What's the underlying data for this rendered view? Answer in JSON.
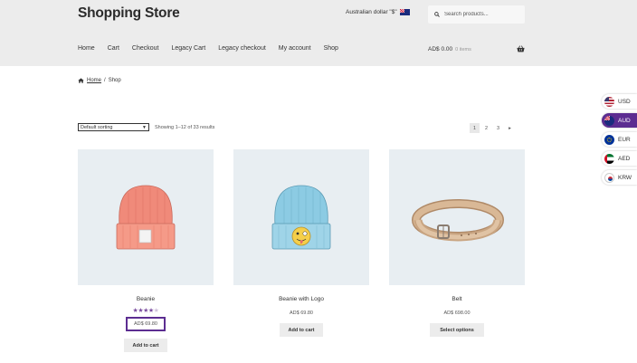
{
  "header": {
    "site_title": "Shopping Store",
    "currency_selected": "Australian dollar \"$\"",
    "search_placeholder": "Search products...",
    "nav": [
      "Home",
      "Cart",
      "Checkout",
      "Legacy Cart",
      "Legacy checkout",
      "My account",
      "Shop"
    ],
    "cart_total": "AD$ 0.00",
    "cart_items": "0 items"
  },
  "breadcrumb": {
    "home": "Home",
    "separator": "/",
    "current": "Shop"
  },
  "toolbar": {
    "sorting": "Default sorting",
    "results": "Showing 1–12 of 33 results",
    "pages": [
      "1",
      "2",
      "3"
    ],
    "next": "▸"
  },
  "products": [
    {
      "name": "Beanie",
      "rating": 4,
      "price": "AD$ 69.80",
      "button": "Add to cart"
    },
    {
      "name": "Beanie with Logo",
      "price": "AD$ 69.80",
      "button": "Add to cart"
    },
    {
      "name": "Belt",
      "price": "AD$ 698.00",
      "button": "Select options"
    }
  ],
  "currency_switcher": [
    {
      "code": "USD",
      "active": false
    },
    {
      "code": "AUD",
      "active": true
    },
    {
      "code": "EUR",
      "active": false
    },
    {
      "code": "AED",
      "active": false
    },
    {
      "code": "KRW",
      "active": false
    }
  ],
  "colors": {
    "accent": "#5c2d91",
    "header_bg": "#ececec",
    "product_bg": "#e8eef2"
  }
}
